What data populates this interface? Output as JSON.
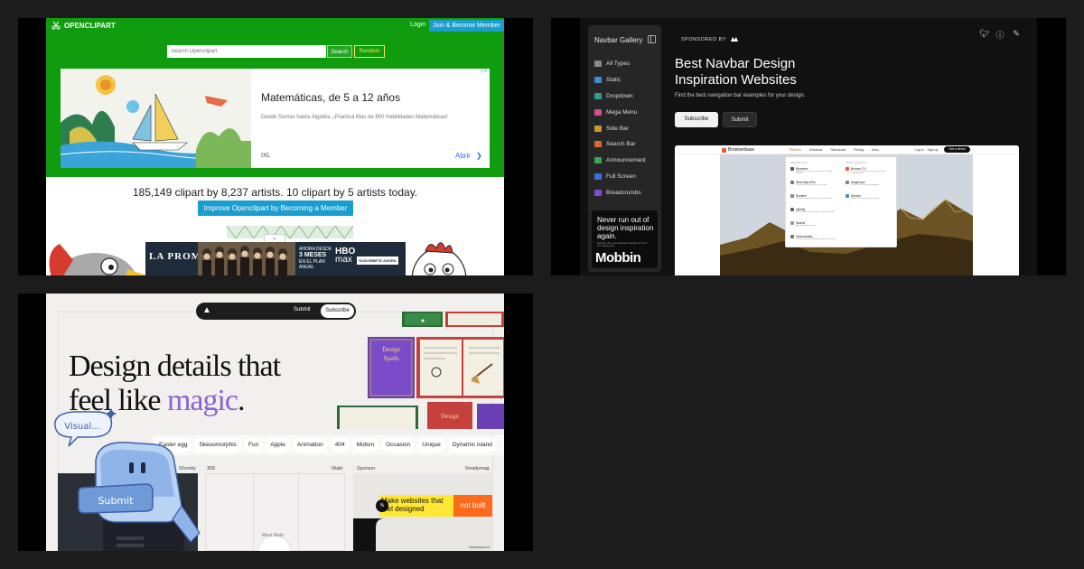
{
  "openclipart": {
    "logo_text": "OPENCLIPART",
    "login": "Login",
    "join": "Join & Become Member",
    "search_placeholder": "Search Openclipart",
    "search_button": "Search",
    "random_button": "Random",
    "ad": {
      "title": "Matemáticas, de 5 a 12 años",
      "description": "Desde Sumas hasta Álgebra, ¡Practicá Más de 800 Habilidades Matemáticas!",
      "brand": "IXL",
      "open_label": "Abrir"
    },
    "stats": "185,149 clipart by 8,237 artists. 10 clipart by 5 artists today.",
    "improve_button": "Improve Openclipart by Becoming a Member",
    "banner": {
      "title": "LA PROMESA",
      "ahora_line1": "AHORA DESDE",
      "ahora_big": "3 MESES",
      "ahora_line2": "EN EL PLAN ANUAL",
      "hbo_line1": "HBO",
      "hbo_line2": "max",
      "subscribe": "SUSCRÍBETE AHORA"
    }
  },
  "navbar_gallery": {
    "sidebar_title": "Navbar Gallery",
    "items": [
      {
        "label": "All Types",
        "color": "#8a8a8a"
      },
      {
        "label": "Static",
        "color": "#3d8bd4"
      },
      {
        "label": "Dropdown",
        "color": "#2f9c8f"
      },
      {
        "label": "Mega Menu",
        "color": "#d2508f"
      },
      {
        "label": "Side Bar",
        "color": "#c79a2e"
      },
      {
        "label": "Search Bar",
        "color": "#d86a2c"
      },
      {
        "label": "Announcement",
        "color": "#3aa65a"
      },
      {
        "label": "Full Screen",
        "color": "#3d6fd4"
      },
      {
        "label": "Breadcrumbs",
        "color": "#7a4fd0"
      }
    ],
    "promo_title": "Never run out of design inspiration again.",
    "promo_small": "Explore the most extensive library of UI & UX references",
    "promo_brand": "Mobbin",
    "sponsored_by": "SPONSORED BY",
    "heading": "Best Navbar Design Inspiration Websites",
    "subheading": "Find the best navigation bar examples for your design.",
    "subscribe": "Subscribe",
    "submit": "Submit",
    "preview": {
      "logo": "Browserbase",
      "nav": [
        "Platform",
        "Solutions",
        "Resources",
        "Pricing",
        "Docs"
      ],
      "login": "Log in",
      "signup": "Sign up",
      "demo": "Get a demo",
      "products_heading": "PRODUCTS",
      "opensource_heading": "OPEN SOURCE",
      "products": [
        {
          "name": "Browsers",
          "desc": "Add browsers for your agents to use, fully scalable"
        },
        {
          "name": "Web Data APIs",
          "desc": "Search and fetch pages on the web"
        },
        {
          "name": "Runtime",
          "desc": "Scalable, cloud-based runtimes for agents"
        },
        {
          "name": "Identity",
          "desc": "Authenticated agents that act on your behalf"
        },
        {
          "name": "Models",
          "desc": "Any AI model you want"
        },
        {
          "name": "Observability",
          "desc": "Follow along with what your agents are doing"
        }
      ],
      "opensource": [
        {
          "name": "Browse CLI",
          "desc": "Give your agent browsing, right from the command line"
        },
        {
          "name": "Stagehand",
          "desc": "The AI web browsing framework"
        },
        {
          "name": "Director",
          "desc": "Automate the web, with prompts"
        }
      ]
    }
  },
  "design_details": {
    "submit": "Submit",
    "subscribe": "Subscribe",
    "heading_line1": "Design details that",
    "heading_line2_a": "feel like ",
    "heading_magic": "magic",
    "heading_period": ".",
    "tags": [
      "Easter egg",
      "Skeuomorphic",
      "Fun",
      "Apple",
      "Animation",
      "404",
      "Motion",
      "Occasion",
      "Unique",
      "Dynamic island"
    ],
    "card1_label": "Ghostty",
    "card2_num": "305",
    "card2_label": "Wabi",
    "card2_inner": "Meet Wabi",
    "card3_sponsor": "Sponsor",
    "card3_label": "Readymag",
    "ready_headline": "Make websites that feel designed",
    "ready_cta": "not built",
    "ready_url": "readymag.com",
    "book1_title": "Design Spells",
    "book2_title": "Design",
    "sticker_visual": "Visual...",
    "sticker_submit": "Submit"
  }
}
